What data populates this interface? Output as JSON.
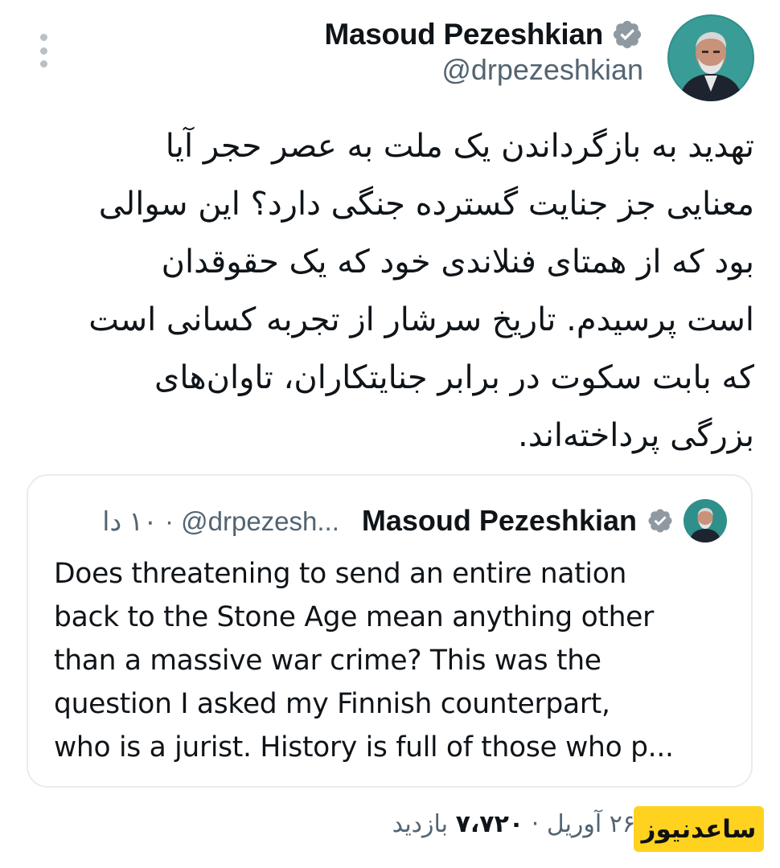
{
  "tweet": {
    "author_name": "Masoud Pezeshkian",
    "author_handle": "@drpezeshkian",
    "body": "تهدید به بازگرداندن یک ملت به عصر حجر آیا\nمعنایی جز جنایت گسترده جنگی دارد؟ این سوالی\nبود که از همتای فنلاندی خود که یک حقوقدان\nاست پرسیدم. تاریخ سرشار از تجربه کسانی است\nکه بابت سکوت در برابر جنایتکاران، تاوان‌های\nبزرگی پرداخته‌اند.",
    "date": "۲۶ آوریل",
    "views_count": "۷،۷۲۰",
    "views_label": "بازدید",
    "separator": "·"
  },
  "quoted_tweet": {
    "author_name": "Masoud Pezeshkian",
    "author_handle": "@drpezesh...",
    "separator": "·",
    "time_ago": "۱۰ دا",
    "lines": [
      "Does threatening to send an entire nation",
      "back to the Stone Age mean anything other",
      "than a massive war crime? This was the",
      "question I asked my Finnish counterpart,",
      "who is a jurist. History is full of those who p..."
    ]
  },
  "watermark": {
    "text": "ساعدنیوز"
  },
  "icons": {
    "more": "more-vertical-icon",
    "verified": "verified-badge-icon"
  },
  "colors": {
    "text_primary": "#0f1419",
    "text_secondary": "#536471",
    "border": "#e6ecf0",
    "badge": "#8e99a2",
    "watermark_bg": "#ffd21f",
    "avatar_bg": "#2f8f8a"
  }
}
